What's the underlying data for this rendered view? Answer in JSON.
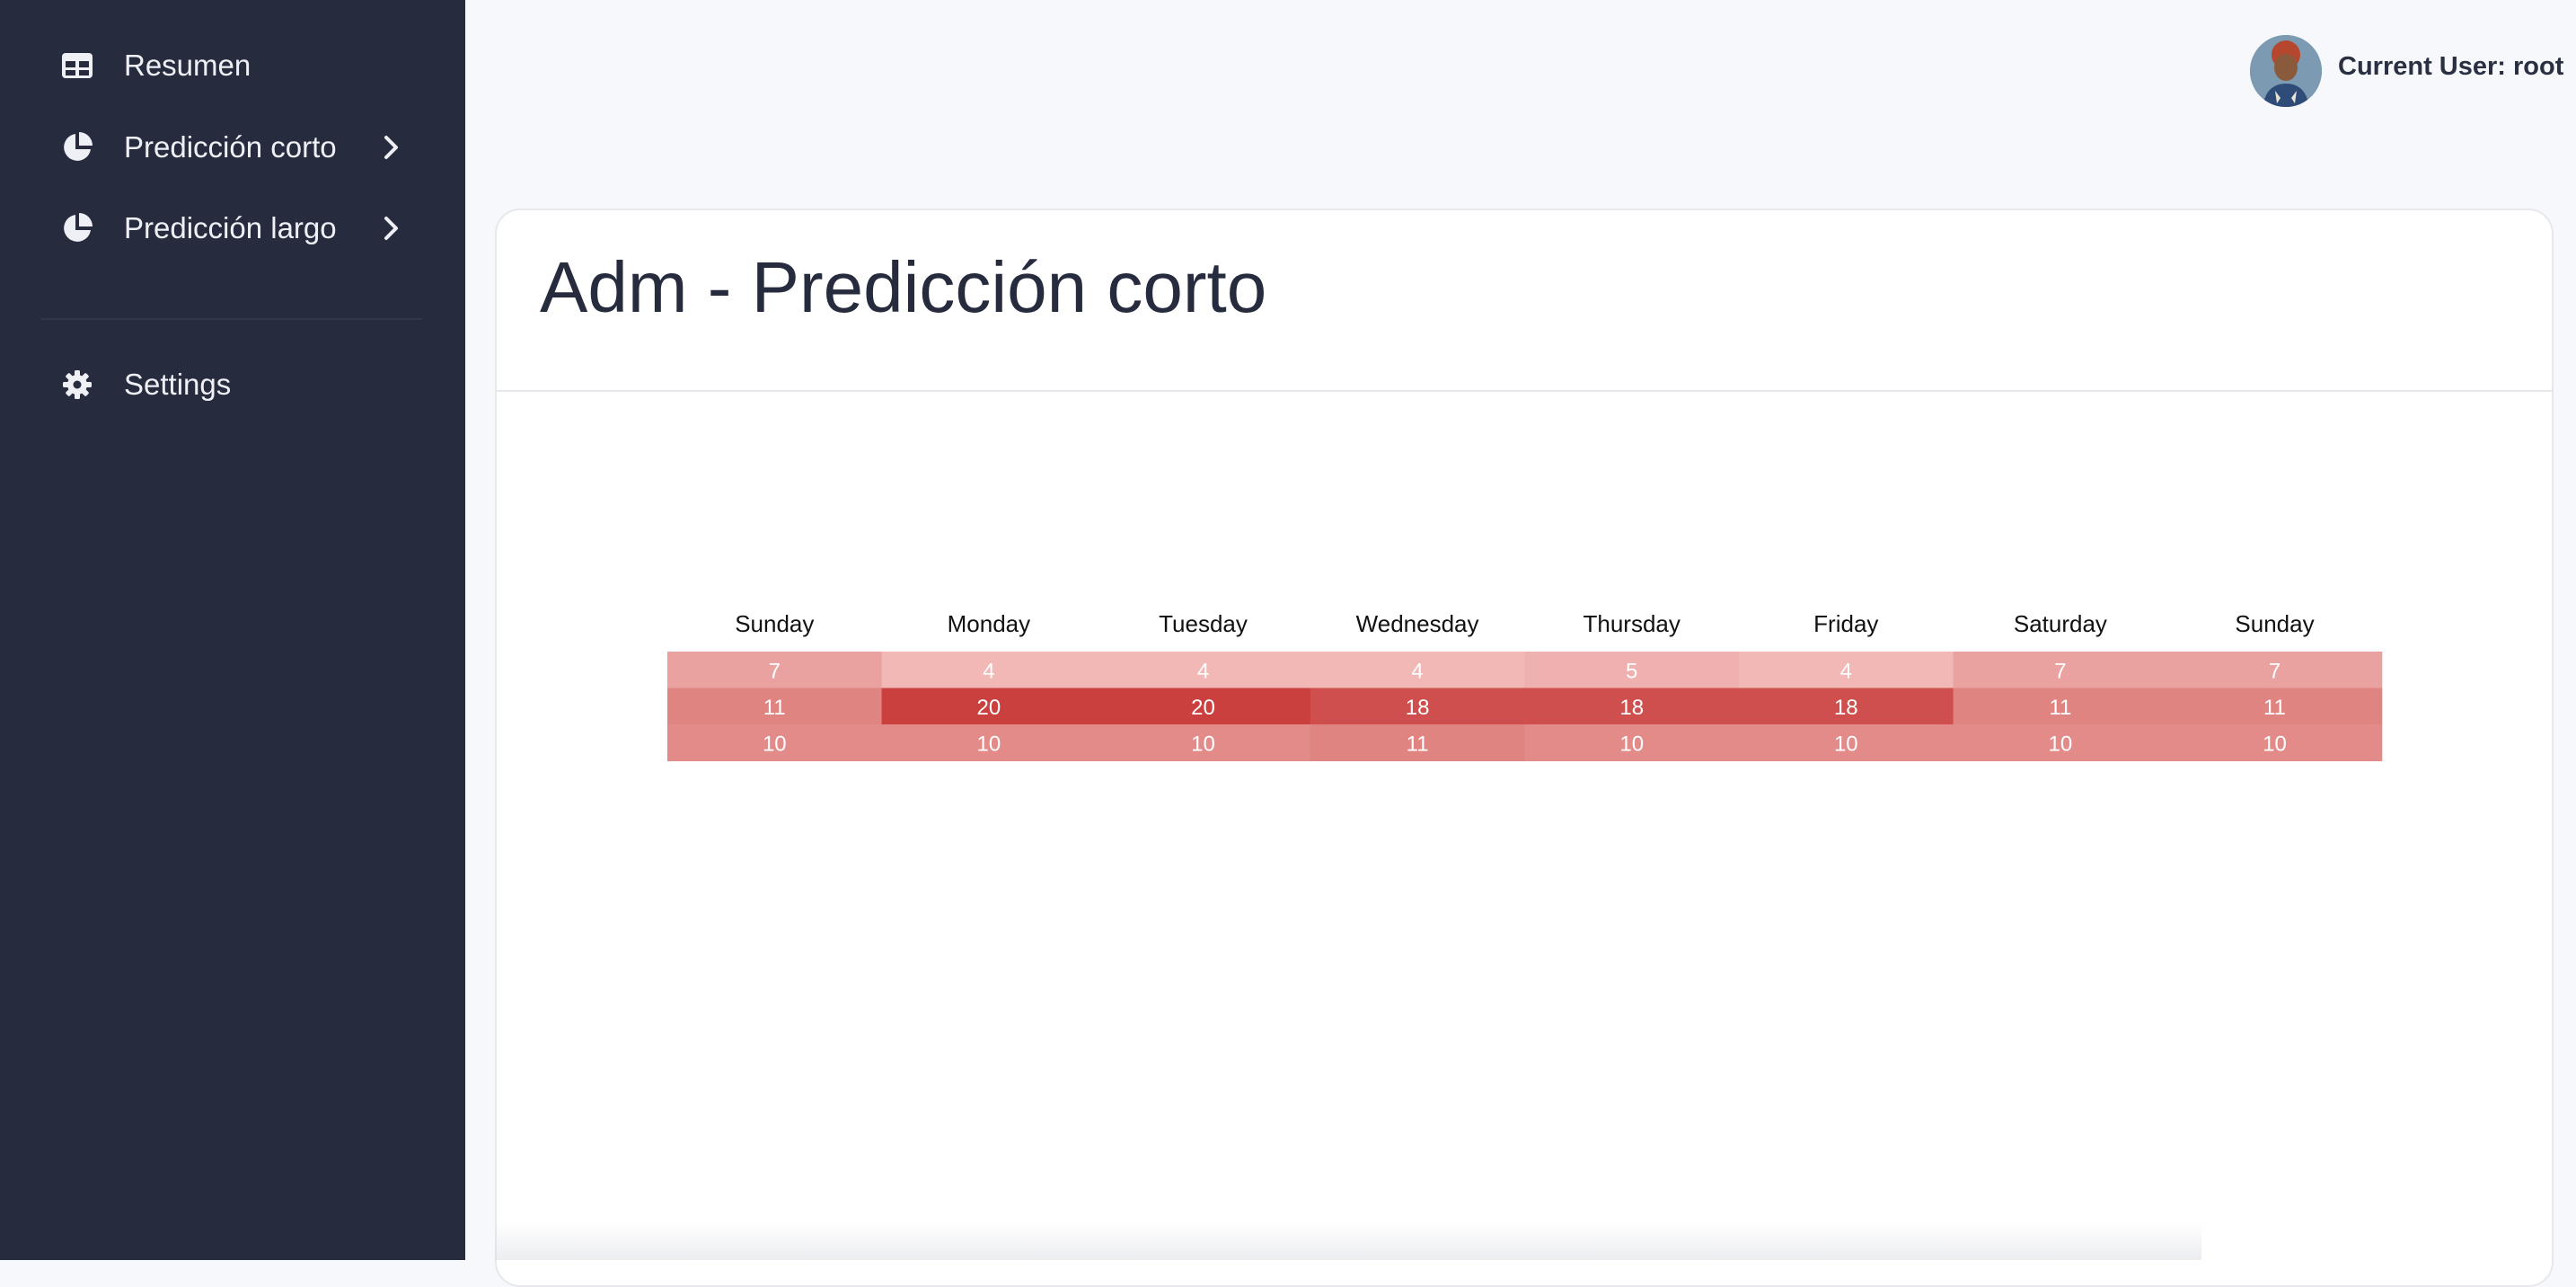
{
  "sidebar": {
    "items": [
      {
        "label": "Resumen",
        "icon": "table-icon",
        "has_submenu": false
      },
      {
        "label": "Predicción corto",
        "icon": "pie-chart-icon",
        "has_submenu": true
      },
      {
        "label": "Predicción largo",
        "icon": "pie-chart-icon",
        "has_submenu": true
      },
      {
        "label": "Settings",
        "icon": "gear-icon",
        "has_submenu": false
      }
    ]
  },
  "header": {
    "user_label": "Current User: root"
  },
  "main": {
    "title": "Adm - Predicción corto"
  },
  "colors": {
    "sidebar_bg": "#262b3e",
    "heat_low": "#f2b8b6",
    "heat_high": "#c9403e"
  },
  "chart_data": {
    "type": "heatmap",
    "columns": [
      "Sunday",
      "Monday",
      "Tuesday",
      "Wednesday",
      "Thursday",
      "Friday",
      "Saturday",
      "Sunday"
    ],
    "rows": [
      [
        7,
        4,
        4,
        4,
        5,
        4,
        7,
        7
      ],
      [
        11,
        20,
        20,
        18,
        18,
        18,
        11,
        11
      ],
      [
        10,
        10,
        10,
        11,
        10,
        10,
        10,
        10
      ]
    ]
  }
}
